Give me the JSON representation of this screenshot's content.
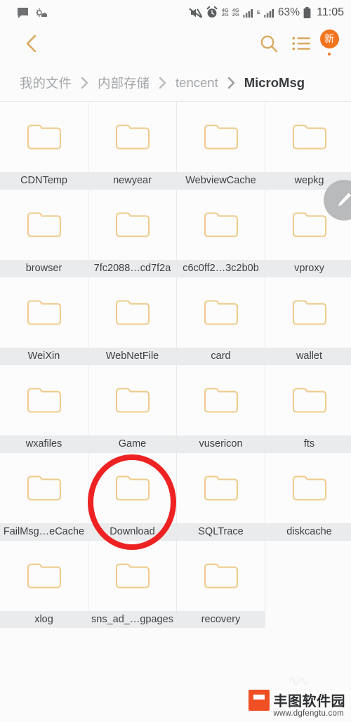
{
  "status_bar": {
    "left_icons": [
      "message-icon",
      "weather-icon"
    ],
    "right_icons": [
      "mute-icon",
      "alarm-icon",
      "signal-4g-dual-icon",
      "signal-bars-icon"
    ],
    "network_primary": "4G",
    "network_secondary": "2G",
    "network_third": "4G",
    "network_edge": "E",
    "battery_percent": "63%",
    "time": "11:05"
  },
  "toolbar": {
    "back_label": "chevron-left",
    "search_label": "search",
    "list_label": "list-view",
    "badge_text": "新"
  },
  "breadcrumb": {
    "separator": "›",
    "items": [
      {
        "label": "我的文件",
        "current": false
      },
      {
        "label": "内部存储",
        "current": false
      },
      {
        "label": "tencent",
        "current": false
      },
      {
        "label": "MicroMsg",
        "current": true
      }
    ]
  },
  "fab": {
    "name": "edit-pencil"
  },
  "grid": {
    "columns": 4,
    "items": [
      {
        "label": "CDNTemp",
        "type": "folder",
        "highlighted": false
      },
      {
        "label": "newyear",
        "type": "folder",
        "highlighted": false
      },
      {
        "label": "WebviewCache",
        "type": "folder",
        "highlighted": false
      },
      {
        "label": "wepkg",
        "type": "folder",
        "highlighted": false
      },
      {
        "label": "browser",
        "type": "folder",
        "highlighted": false
      },
      {
        "label": "7fc2088…cd7f2a",
        "type": "folder",
        "highlighted": false
      },
      {
        "label": "c6c0ff2…3c2b0b",
        "type": "folder",
        "highlighted": false
      },
      {
        "label": "vproxy",
        "type": "folder",
        "highlighted": false
      },
      {
        "label": "WeiXin",
        "type": "folder",
        "highlighted": false
      },
      {
        "label": "WebNetFile",
        "type": "folder",
        "highlighted": false
      },
      {
        "label": "card",
        "type": "folder",
        "highlighted": false
      },
      {
        "label": "wallet",
        "type": "folder",
        "highlighted": false
      },
      {
        "label": "wxafiles",
        "type": "folder",
        "highlighted": false
      },
      {
        "label": "Game",
        "type": "folder",
        "highlighted": false
      },
      {
        "label": "vusericon",
        "type": "folder",
        "highlighted": false
      },
      {
        "label": "fts",
        "type": "folder",
        "highlighted": false
      },
      {
        "label": "FailMsg…eCache",
        "type": "folder",
        "highlighted": false
      },
      {
        "label": "Download",
        "type": "folder",
        "highlighted": true
      },
      {
        "label": "SQLTrace",
        "type": "folder",
        "highlighted": false
      },
      {
        "label": "diskcache",
        "type": "folder",
        "highlighted": false
      },
      {
        "label": "xlog",
        "type": "folder",
        "highlighted": false
      },
      {
        "label": "sns_ad_…gpages",
        "type": "folder",
        "highlighted": false
      },
      {
        "label": "recovery",
        "type": "folder",
        "highlighted": false
      },
      {
        "label": "",
        "type": "empty",
        "highlighted": false
      }
    ]
  },
  "annotation": {
    "target": "Download",
    "shape": "ellipse",
    "color": "#ee2222"
  },
  "watermark": {
    "name_cn": "丰图软件园",
    "url": "www.dgfengtu.com"
  },
  "colors": {
    "folder_outline": "#efcb8d",
    "accent_orange": "#e9a54a",
    "badge_orange": "#f2741f",
    "annotation_red": "#ee2222",
    "label_band": "#eaebec",
    "page_bg": "#fbfbfb"
  }
}
